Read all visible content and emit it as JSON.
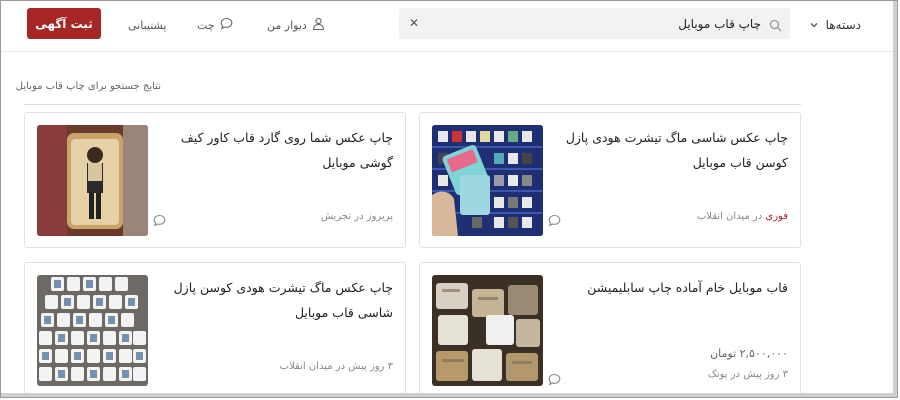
{
  "header": {
    "categories_label": "دسته‌ها",
    "search_value": "چاپ قاب موبایل",
    "search_placeholder": "",
    "my_wall_label": "دیوار من",
    "chat_label": "چت",
    "support_label": "پشتیبانی",
    "post_button_label": "ثبت آگهی"
  },
  "results": {
    "heading": "نتایج جستجو برای چاپ قاب موبایل"
  },
  "cards": [
    {
      "title": "چاپ عکس شاسی ماگ تیشرت هودی پازل کوسن قاب موبایل",
      "price": "",
      "badge": "فوری",
      "meta": "در میدان انقلاب"
    },
    {
      "title": "چاپ عکس شما روی گارد قاب کاور کیف گوشی موبایل",
      "price": "",
      "badge": "",
      "meta": "پریروز در تجریش"
    },
    {
      "title": "قاب موبایل خام آماده چاپ سابلیمیشن",
      "price": "۲,۵۰۰,۰۰۰ تومان",
      "badge": "",
      "meta": "۳ روز پیش در پونک"
    },
    {
      "title": "چاپ عکس ماگ تیشرت هودی کوسن پازل شاسی قاب موبایل",
      "price": "",
      "badge": "",
      "meta": "۳ روز پیش در میدان انقلاب"
    }
  ],
  "colors": {
    "brand": "#a62626",
    "text": "#222222",
    "muted": "#888888"
  },
  "icons": {
    "categories": "chevron-down-icon",
    "search": "search-icon",
    "clear": "close-icon",
    "user": "user-icon",
    "chat": "chat-icon"
  }
}
